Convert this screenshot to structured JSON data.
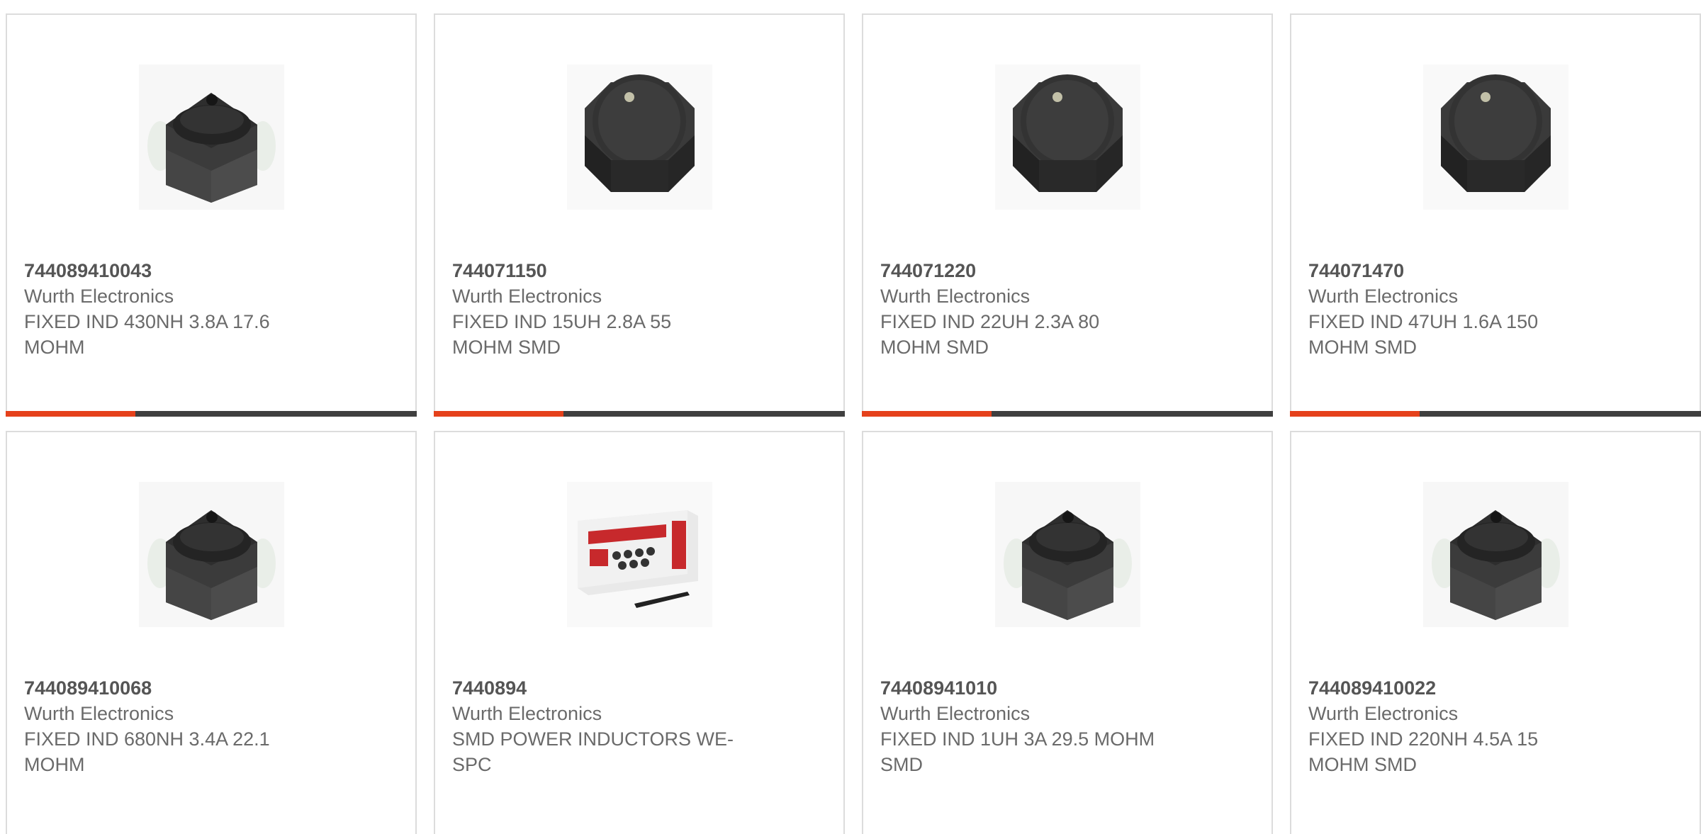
{
  "products": [
    {
      "part_number": "744089410043",
      "manufacturer": "Wurth Electronics",
      "description": "FIXED IND 430NH 3.8A 17.6 MOHM",
      "image": "shielded-inductor-square-icon"
    },
    {
      "part_number": "744071150",
      "manufacturer": "Wurth Electronics",
      "description": "FIXED IND 15UH 2.8A 55 MOHM SMD",
      "image": "octagonal-inductor-icon"
    },
    {
      "part_number": "744071220",
      "manufacturer": "Wurth Electronics",
      "description": "FIXED IND 22UH 2.3A 80 MOHM SMD",
      "image": "octagonal-inductor-icon"
    },
    {
      "part_number": "744071470",
      "manufacturer": "Wurth Electronics",
      "description": "FIXED IND 47UH 1.6A 150 MOHM SMD",
      "image": "octagonal-inductor-icon"
    },
    {
      "part_number": "744089410068",
      "manufacturer": "Wurth Electronics",
      "description": "FIXED IND 680NH 3.4A 22.1 MOHM",
      "image": "shielded-inductor-square-icon"
    },
    {
      "part_number": "7440894",
      "manufacturer": "Wurth Electronics",
      "description": "SMD POWER INDUCTORS WE-SPC",
      "image": "design-kit-box-icon"
    },
    {
      "part_number": "74408941010",
      "manufacturer": "Wurth Electronics",
      "description": "FIXED IND 1UH 3A 29.5 MOHM SMD",
      "image": "shielded-inductor-square-icon"
    },
    {
      "part_number": "744089410022",
      "manufacturer": "Wurth Electronics",
      "description": "FIXED IND 220NH 4.5A 15 MOHM SMD",
      "image": "shielded-inductor-square-icon"
    }
  ],
  "colors": {
    "accent": "#e5411b",
    "bar": "#3f3f3f",
    "border": "#dcdcdc",
    "text": "#6a6a6a"
  }
}
